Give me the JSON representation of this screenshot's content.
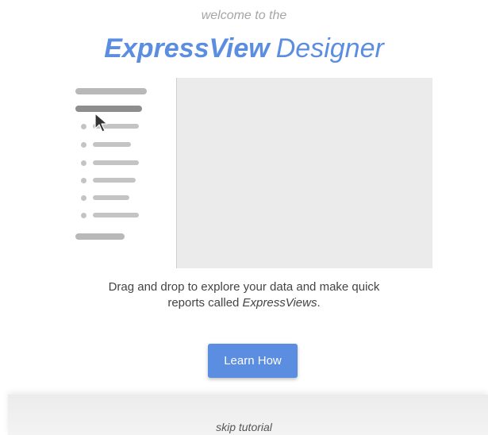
{
  "header": {
    "welcome_text": "welcome to the",
    "title_brand": "ExpressView",
    "title_suffix": "Designer"
  },
  "description": {
    "line1": "Drag and drop to explore your data and make quick",
    "line2_prefix": "reports called ",
    "line2_em": "ExpressViews",
    "line2_suffix": "."
  },
  "actions": {
    "learn_how_label": "Learn How",
    "skip_label": "skip tutorial"
  },
  "colors": {
    "accent": "#5b8de0",
    "canvas": "#ebebeb",
    "muted_text": "#a6a6a6"
  }
}
